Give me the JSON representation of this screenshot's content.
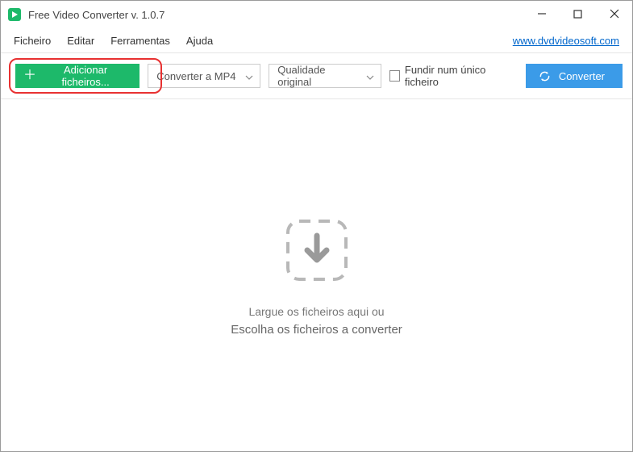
{
  "titlebar": {
    "title": "Free Video Converter v. 1.0.7"
  },
  "menubar": {
    "items": [
      "Ficheiro",
      "Editar",
      "Ferramentas",
      "Ajuda"
    ],
    "link": "www.dvdvideosoft.com"
  },
  "toolbar": {
    "add_files_label": "Adicionar ficheiros...",
    "format_selected": "Converter a MP4",
    "quality_selected": "Qualidade original",
    "merge_label": "Fundir num único ficheiro",
    "convert_label": "Converter"
  },
  "droparea": {
    "line1": "Largue os ficheiros aqui ou",
    "line2": "Escolha os ficheiros a converter"
  }
}
